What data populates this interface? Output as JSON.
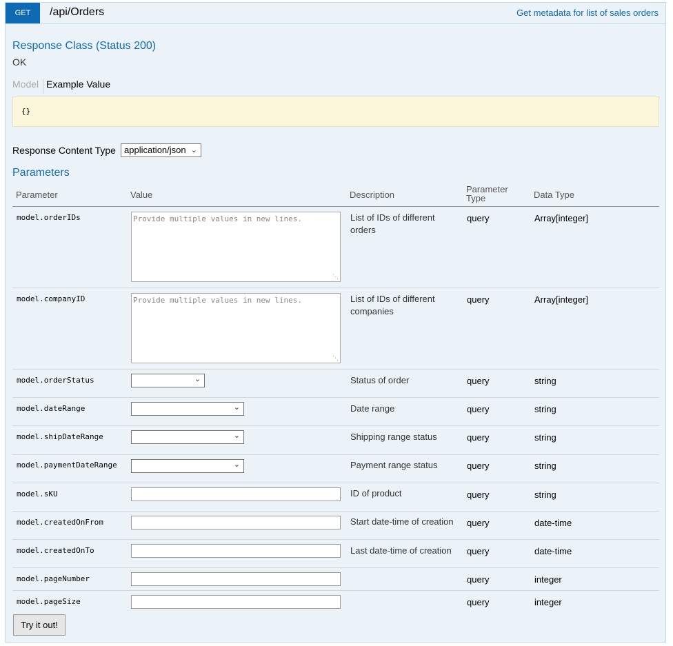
{
  "operation": {
    "method": "GET",
    "path": "/api/Orders",
    "summary": "Get metadata for list of sales orders"
  },
  "response": {
    "class_title": "Response Class (Status 200)",
    "status_text": "OK",
    "tabs": [
      "Model",
      "Example Value"
    ],
    "example_value": "{}"
  },
  "content_type": {
    "label": "Response Content Type",
    "value": "application/json"
  },
  "parameters": {
    "title": "Parameters",
    "headers": [
      "Parameter",
      "Value",
      "Description",
      "Parameter Type",
      "Data Type"
    ],
    "placeholder": "Provide multiple values in new lines.",
    "rows": [
      {
        "name": "model.orderIDs",
        "description": "List of IDs of different orders",
        "param_type": "query",
        "data_type": "Array[integer]"
      },
      {
        "name": "model.companyID",
        "description": "List of IDs of different companies",
        "param_type": "query",
        "data_type": "Array[integer]"
      },
      {
        "name": "model.orderStatus",
        "description": "Status of order",
        "param_type": "query",
        "data_type": "string"
      },
      {
        "name": "model.dateRange",
        "description": "Date range",
        "param_type": "query",
        "data_type": "string"
      },
      {
        "name": "model.shipDateRange",
        "description": "Shipping range status",
        "param_type": "query",
        "data_type": "string"
      },
      {
        "name": "model.paymentDateRange",
        "description": "Payment range status",
        "param_type": "query",
        "data_type": "string"
      },
      {
        "name": "model.sKU",
        "description": "ID of product",
        "param_type": "query",
        "data_type": "string"
      },
      {
        "name": "model.createdOnFrom",
        "description": "Start date-time of creation",
        "param_type": "query",
        "data_type": "date-time"
      },
      {
        "name": "model.createdOnTo",
        "description": "Last date-time of creation",
        "param_type": "query",
        "data_type": "date-time"
      },
      {
        "name": "model.pageNumber",
        "description": "",
        "param_type": "query",
        "data_type": "integer"
      },
      {
        "name": "model.pageSize",
        "description": "",
        "param_type": "query",
        "data_type": "integer"
      }
    ]
  },
  "try_button": "Try it out!",
  "colors": {
    "accent": "#0f6ab4",
    "panel_bg": "#ebf3f9",
    "sample_bg": "#fcf6db"
  }
}
